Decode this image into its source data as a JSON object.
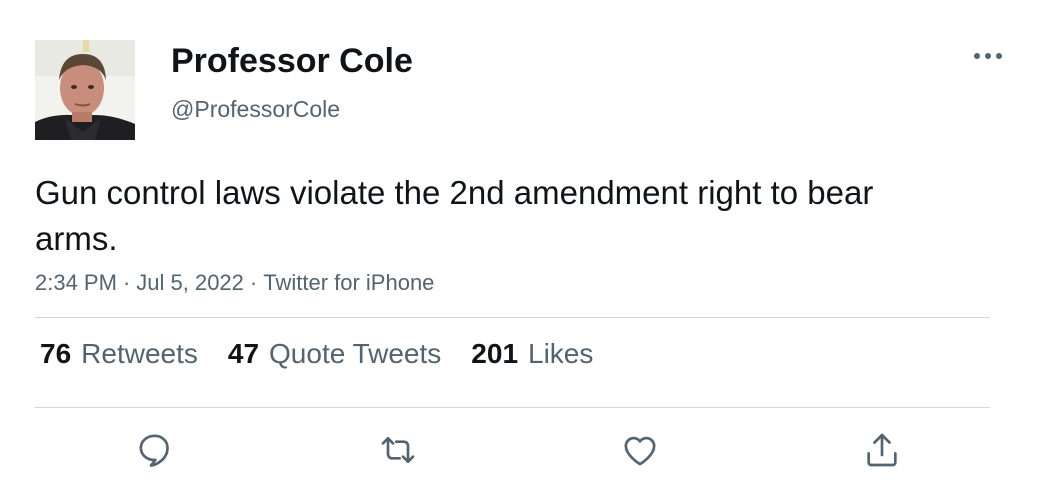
{
  "author": {
    "display_name": "Professor Cole",
    "handle": "@ProfessorCole",
    "avatar_icon": "profile-photo"
  },
  "tweet": {
    "text": "Gun control laws violate the 2nd amendment right to bear arms.",
    "time": "2:34 PM",
    "date": "Jul 5, 2022",
    "source": "Twitter for iPhone",
    "separator": "·"
  },
  "stats": {
    "retweets_count": "76",
    "retweets_label": "Retweets",
    "quote_tweets_count": "47",
    "quote_tweets_label": "Quote Tweets",
    "likes_count": "201",
    "likes_label": "Likes"
  },
  "actions": {
    "reply_icon": "reply-icon",
    "retweet_icon": "retweet-icon",
    "like_icon": "heart-icon",
    "share_icon": "share-icon",
    "more_icon": "more-icon"
  },
  "colors": {
    "text_primary": "#0f1419",
    "text_secondary": "#536471",
    "divider": "#cfd9de"
  }
}
